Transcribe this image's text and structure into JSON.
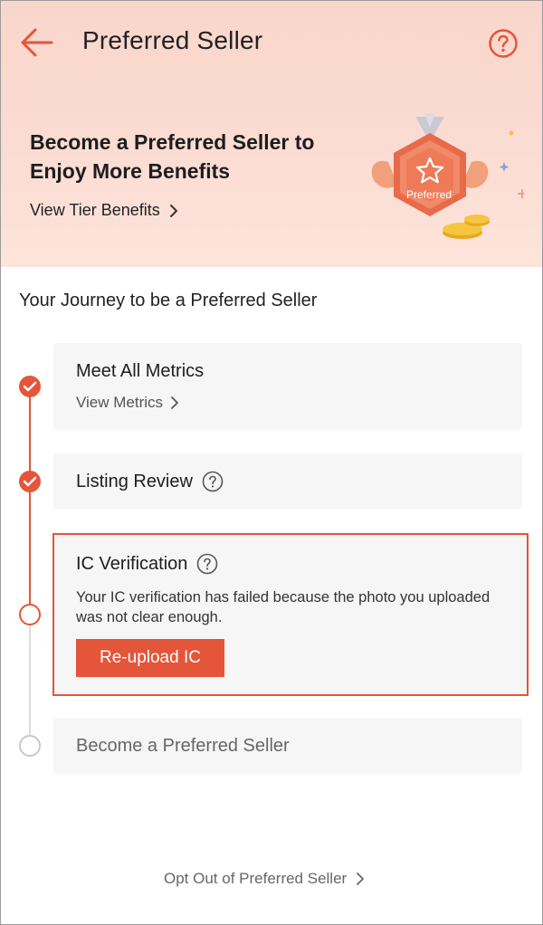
{
  "header": {
    "title": "Preferred Seller",
    "back_icon": "arrow-left-icon",
    "help_icon": "question-circle-icon"
  },
  "banner": {
    "headline": "Become a Preferred Seller to Enjoy More Benefits",
    "tier_link": "View Tier Benefits",
    "badge_text": "Preferred"
  },
  "journey": {
    "title": "Your Journey to be a Preferred Seller",
    "steps": [
      {
        "title": "Meet All Metrics",
        "link": "View Metrics",
        "status": "done"
      },
      {
        "title": "Listing Review",
        "status": "done"
      },
      {
        "title": "IC Verification",
        "status": "current",
        "message": "Your IC verification has failed because the photo you uploaded was not clear enough.",
        "button": "Re-upload IC"
      },
      {
        "title": "Become a Preferred Seller",
        "status": "pending"
      }
    ]
  },
  "footer": {
    "opt_out": "Opt Out of Preferred Seller"
  },
  "colors": {
    "accent": "#e4553a",
    "banner_bg": "#fbdcd2",
    "card_bg": "#f6f6f6"
  }
}
